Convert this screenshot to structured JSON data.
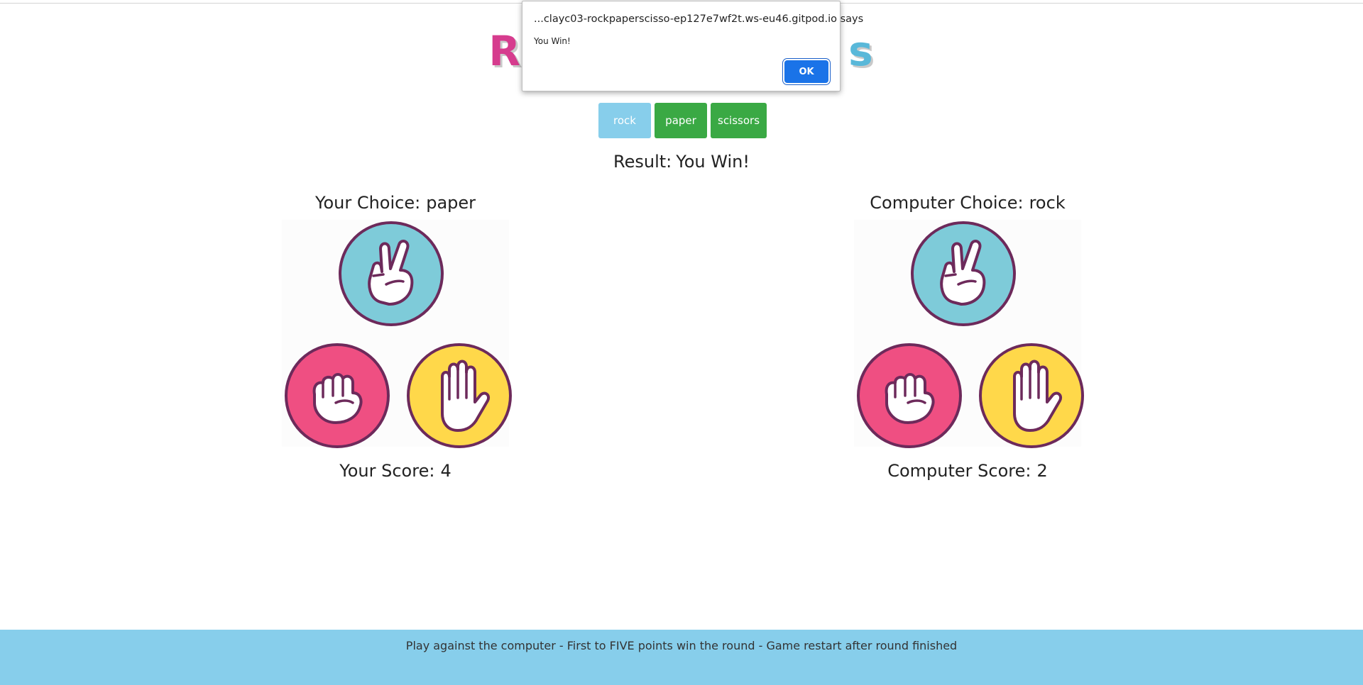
{
  "app": {
    "title_left": "R",
    "title_right": "s"
  },
  "choices": {
    "rock_label": "rock",
    "paper_label": "paper",
    "scissors_label": "scissors"
  },
  "result": {
    "label": "Result:",
    "value": "You Win!"
  },
  "player": {
    "choice_label": "Your Choice:",
    "choice_value": "paper",
    "score_label": "Your Score:",
    "score_value": "4"
  },
  "computer": {
    "choice_label": "Computer Choice:",
    "choice_value": "rock",
    "score_label": "Computer Score:",
    "score_value": "2"
  },
  "footer": {
    "text": "Play against the computer - First to FIVE points win the round - Game restart after round finished"
  },
  "dialog": {
    "origin": "...clayc03-rockpaperscisso-ep127e7wf2t.ws-eu46.gitpod.io says",
    "message": "You Win!",
    "ok_label": "OK"
  },
  "colors": {
    "scissors_circle": "#7ecbd9",
    "rock_circle": "#ef4f82",
    "paper_circle": "#ffd84a",
    "circle_border": "#6d2a5b",
    "button_green": "#3aa944",
    "button_rock": "#87ceeb",
    "footer_bg": "#87ceeb",
    "dialog_ok": "#1a73e8"
  },
  "icons": [
    "scissors-hand-icon",
    "rock-fist-icon",
    "paper-hand-icon"
  ]
}
